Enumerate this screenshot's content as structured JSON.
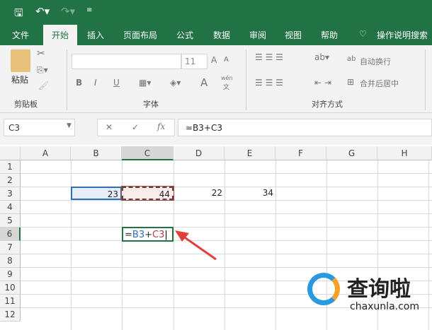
{
  "quick_access": {
    "save_icon": "save-icon",
    "undo_icon": "undo-icon",
    "redo_icon": "redo-icon",
    "customize_icon": "customize-icon"
  },
  "tabs": [
    "文件",
    "开始",
    "插入",
    "页面布局",
    "公式",
    "数据",
    "审阅",
    "视图",
    "帮助"
  ],
  "active_tab": "开始",
  "tell_me": "操作说明搜索",
  "ribbon": {
    "clipboard": {
      "paste": "粘贴",
      "group": "剪贴板"
    },
    "font": {
      "font_name": "",
      "font_size": "11",
      "bold": "B",
      "italic": "I",
      "underline": "U",
      "font_color": "A",
      "grow": "A",
      "shrink": "A",
      "phonetic": "wén",
      "phonetic2": "文",
      "group": "字体"
    },
    "alignment": {
      "wrap_text": "自动换行",
      "merge_center": "合并后居中",
      "group": "对齐方式"
    }
  },
  "formula_bar": {
    "name_box": "C3",
    "cancel": "✕",
    "enter": "✓",
    "fx": "fx",
    "formula": "=B3+C3"
  },
  "columns": [
    "A",
    "B",
    "C",
    "D",
    "E",
    "F",
    "G",
    "H"
  ],
  "rows": [
    "1",
    "2",
    "3",
    "4",
    "5",
    "6",
    "7",
    "8",
    "9",
    "10",
    "11",
    "12"
  ],
  "cells": {
    "B3": "23",
    "C3": "44",
    "D3": "22",
    "E3": "34"
  },
  "editing_cell": {
    "ref": "C6",
    "eq": "=",
    "ref1": "B3",
    "plus": "+",
    "ref2": "C3"
  },
  "colors": {
    "excel_green": "#217346",
    "ref1": "#2f6db5",
    "ref2": "#b13b4a",
    "arrow": "#e0413a"
  },
  "watermark": {
    "name": "查询啦",
    "url": "chaxunla.com"
  }
}
